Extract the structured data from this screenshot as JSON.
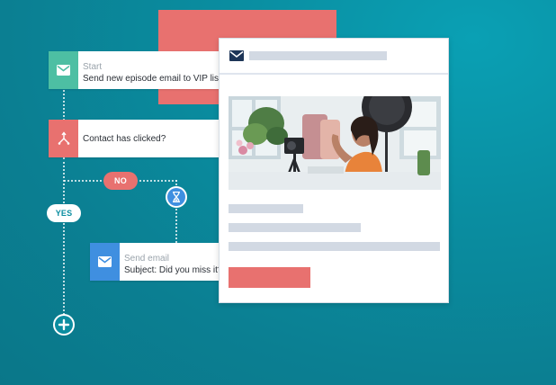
{
  "workflow": {
    "start_step": {
      "sublabel": "Start",
      "label": "Send new episode email to VIP list",
      "icon": "envelope-icon",
      "color": "#4dbfa3"
    },
    "condition_step": {
      "label": "Contact has clicked?",
      "icon": "branch-icon",
      "color": "#e8716f"
    },
    "no_branch": {
      "label": "NO",
      "color": "#e8716f"
    },
    "yes_branch": {
      "label": "YES"
    },
    "delay_icon": "hourglass-icon",
    "send_step": {
      "sublabel": "Send email",
      "label": "Subject: Did you miss it?",
      "icon": "envelope-icon",
      "color": "#3f8fe0"
    },
    "add_icon": "plus-icon"
  },
  "email_preview": {
    "header_icon": "envelope-icon",
    "accent": "#e8716f",
    "image": "woman-recording-video-photo"
  },
  "colors": {
    "background": "#0a8ea1",
    "accent_red": "#e8716f",
    "accent_green": "#4dbfa3",
    "accent_blue": "#3f8fe0",
    "navy": "#1d3557"
  }
}
